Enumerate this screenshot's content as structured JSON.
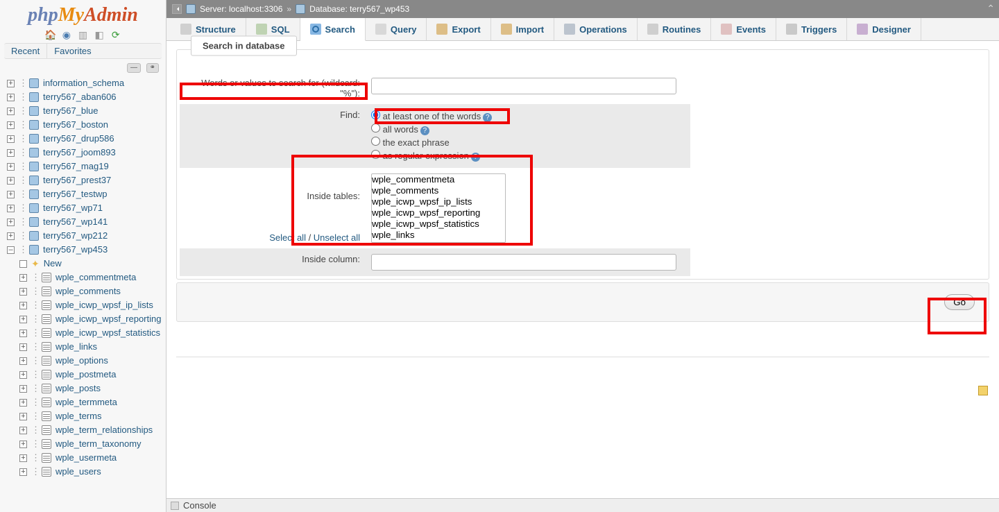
{
  "logo": {
    "p1": "php",
    "p2": "My",
    "p3": "Admin"
  },
  "sidebar": {
    "recent": "Recent",
    "favorites": "Favorites",
    "dbs": [
      "information_schema",
      "terry567_aban606",
      "terry567_blue",
      "terry567_boston",
      "terry567_drup586",
      "terry567_joom893",
      "terry567_mag19",
      "terry567_prest37",
      "terry567_testwp",
      "terry567_wp71",
      "terry567_wp141",
      "terry567_wp212"
    ],
    "active_db": "terry567_wp453",
    "newlabel": "New",
    "tables": [
      "wple_commentmeta",
      "wple_comments",
      "wple_icwp_wpsf_ip_lists",
      "wple_icwp_wpsf_reporting",
      "wple_icwp_wpsf_statistics",
      "wple_links",
      "wple_options",
      "wple_postmeta",
      "wple_posts",
      "wple_termmeta",
      "wple_terms",
      "wple_term_relationships",
      "wple_term_taxonomy",
      "wple_usermeta",
      "wple_users"
    ]
  },
  "breadcrumb": {
    "server_lbl": "Server: ",
    "server": "localhost:3306",
    "db_lbl": "Database: ",
    "db": "terry567_wp453"
  },
  "tabs": [
    "Structure",
    "SQL",
    "Search",
    "Query",
    "Export",
    "Import",
    "Operations",
    "Routines",
    "Events",
    "Triggers",
    "Designer"
  ],
  "form": {
    "fieldset": "Search in database",
    "words_lbl": "Words or values to search for (wildcard: \"%\"):",
    "find_lbl": "Find:",
    "find_opts": [
      "at least one of the words",
      "all words",
      "the exact phrase",
      "as regular expression"
    ],
    "inside_tables_lbl": "Inside tables:",
    "table_opts": [
      "wple_commentmeta",
      "wple_comments",
      "wple_icwp_wpsf_ip_lists",
      "wple_icwp_wpsf_reporting",
      "wple_icwp_wpsf_statistics",
      "wple_links"
    ],
    "selectall": "Select all",
    "unselectall": "Unselect all",
    "sep": " / ",
    "inside_col_lbl": "Inside column:",
    "go": "Go"
  },
  "console": "Console"
}
